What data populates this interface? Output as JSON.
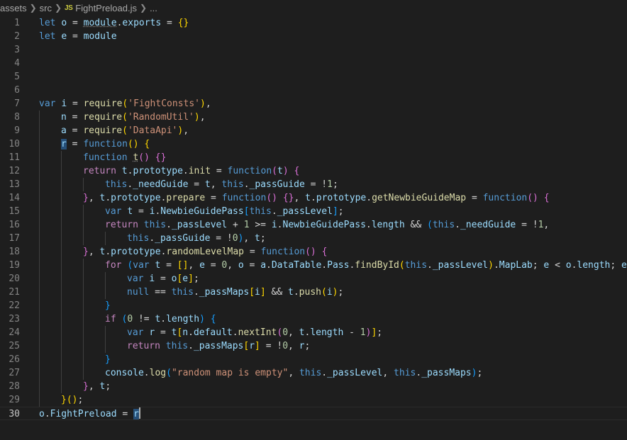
{
  "breadcrumb": {
    "items": [
      "assets",
      "src",
      "FightPreload.js",
      "..."
    ],
    "file_icon": "JS"
  },
  "editor": {
    "current_line": 30,
    "lines": [
      {
        "n": "1",
        "indent": 0,
        "tokens": [
          [
            "let",
            "kw"
          ],
          [
            " "
          ],
          [
            "o",
            "var"
          ],
          [
            " = "
          ],
          [
            "module",
            "var",
            "dot"
          ],
          [
            "."
          ],
          [
            "exports",
            "var"
          ],
          [
            " = "
          ],
          [
            "{}",
            "b1"
          ]
        ]
      },
      {
        "n": "2",
        "indent": 0,
        "tokens": [
          [
            "let",
            "kw"
          ],
          [
            " "
          ],
          [
            "e",
            "var"
          ],
          [
            " = "
          ],
          [
            "module",
            "var"
          ]
        ]
      },
      {
        "n": "3",
        "indent": 0,
        "tokens": []
      },
      {
        "n": "4",
        "indent": 0,
        "tokens": []
      },
      {
        "n": "5",
        "indent": 0,
        "tokens": []
      },
      {
        "n": "6",
        "indent": 0,
        "tokens": []
      },
      {
        "n": "7",
        "indent": 0,
        "tokens": [
          [
            "var",
            "kw"
          ],
          [
            " "
          ],
          [
            "i",
            "var"
          ],
          [
            " = "
          ],
          [
            "require",
            "fn"
          ],
          [
            "(",
            "b1"
          ],
          [
            "'FightConsts'",
            "str"
          ],
          [
            ")",
            "b1"
          ],
          [
            ","
          ]
        ]
      },
      {
        "n": "8",
        "indent": 1,
        "tokens": [
          [
            "n",
            "var"
          ],
          [
            " = "
          ],
          [
            "require",
            "fn"
          ],
          [
            "(",
            "b1"
          ],
          [
            "'RandomUtil'",
            "str"
          ],
          [
            ")",
            "b1"
          ],
          [
            ","
          ]
        ]
      },
      {
        "n": "9",
        "indent": 1,
        "tokens": [
          [
            "a",
            "var"
          ],
          [
            " = "
          ],
          [
            "require",
            "fn"
          ],
          [
            "(",
            "b1"
          ],
          [
            "'DataApi'",
            "str"
          ],
          [
            ")",
            "b1"
          ],
          [
            ","
          ]
        ]
      },
      {
        "n": "10",
        "indent": 1,
        "tokens": [
          [
            "r",
            "var",
            "hl"
          ],
          [
            " = "
          ],
          [
            "function",
            "kw"
          ],
          [
            "()",
            "b1"
          ],
          [
            " "
          ],
          [
            "{",
            "b1"
          ]
        ]
      },
      {
        "n": "11",
        "indent": 2,
        "tokens": [
          [
            "function",
            "kw"
          ],
          [
            " "
          ],
          [
            "t",
            "fn",
            "dot"
          ],
          [
            "()",
            "b2"
          ],
          [
            " "
          ],
          [
            "{}",
            "b2"
          ]
        ]
      },
      {
        "n": "12",
        "indent": 2,
        "tokens": [
          [
            "return",
            "ctl"
          ],
          [
            " "
          ],
          [
            "t",
            "var"
          ],
          [
            "."
          ],
          [
            "prototype",
            "var"
          ],
          [
            "."
          ],
          [
            "init",
            "fn"
          ],
          [
            " = "
          ],
          [
            "function",
            "kw"
          ],
          [
            "(",
            "b2"
          ],
          [
            "t",
            "var"
          ],
          [
            ")",
            "b2"
          ],
          [
            " "
          ],
          [
            "{",
            "b2"
          ]
        ]
      },
      {
        "n": "13",
        "indent": 3,
        "tokens": [
          [
            "this",
            "kw"
          ],
          [
            "."
          ],
          [
            "_needGuide",
            "var"
          ],
          [
            " = "
          ],
          [
            "t",
            "var"
          ],
          [
            ", "
          ],
          [
            "this",
            "kw"
          ],
          [
            "."
          ],
          [
            "_passGuide",
            "var"
          ],
          [
            " = !"
          ],
          [
            "1",
            "num"
          ],
          [
            ";"
          ]
        ]
      },
      {
        "n": "14",
        "indent": 2,
        "tokens": [
          [
            "}",
            "b2"
          ],
          [
            ", "
          ],
          [
            "t",
            "var"
          ],
          [
            "."
          ],
          [
            "prototype",
            "var"
          ],
          [
            "."
          ],
          [
            "prepare",
            "fn"
          ],
          [
            " = "
          ],
          [
            "function",
            "kw"
          ],
          [
            "()",
            "b2"
          ],
          [
            " "
          ],
          [
            "{}",
            "b2"
          ],
          [
            ", "
          ],
          [
            "t",
            "var"
          ],
          [
            "."
          ],
          [
            "prototype",
            "var"
          ],
          [
            "."
          ],
          [
            "getNewbieGuideMap",
            "fn"
          ],
          [
            " = "
          ],
          [
            "function",
            "kw"
          ],
          [
            "()",
            "b2"
          ],
          [
            " "
          ],
          [
            "{",
            "b2"
          ]
        ]
      },
      {
        "n": "15",
        "indent": 3,
        "tokens": [
          [
            "var",
            "kw"
          ],
          [
            " "
          ],
          [
            "t",
            "var"
          ],
          [
            " = "
          ],
          [
            "i",
            "var"
          ],
          [
            "."
          ],
          [
            "NewbieGuidePass",
            "var"
          ],
          [
            "[",
            "b3"
          ],
          [
            "this",
            "kw"
          ],
          [
            "."
          ],
          [
            "_passLevel",
            "var"
          ],
          [
            "]",
            "b3"
          ],
          [
            ";"
          ]
        ]
      },
      {
        "n": "16",
        "indent": 3,
        "tokens": [
          [
            "return",
            "ctl"
          ],
          [
            " "
          ],
          [
            "this",
            "kw"
          ],
          [
            "."
          ],
          [
            "_passLevel",
            "var"
          ],
          [
            " + "
          ],
          [
            "1",
            "num"
          ],
          [
            " >= "
          ],
          [
            "i",
            "var"
          ],
          [
            "."
          ],
          [
            "NewbieGuidePass",
            "var"
          ],
          [
            "."
          ],
          [
            "length",
            "var"
          ],
          [
            " && "
          ],
          [
            "(",
            "b3"
          ],
          [
            "this",
            "kw"
          ],
          [
            "."
          ],
          [
            "_needGuide",
            "var"
          ],
          [
            " = !"
          ],
          [
            "1",
            "num"
          ],
          [
            ","
          ]
        ]
      },
      {
        "n": "17",
        "indent": 4,
        "tokens": [
          [
            "this",
            "kw"
          ],
          [
            "."
          ],
          [
            "_passGuide",
            "var"
          ],
          [
            " = !"
          ],
          [
            "0",
            "num"
          ],
          [
            ")",
            "b3"
          ],
          [
            ", "
          ],
          [
            "t",
            "var"
          ],
          [
            ";"
          ]
        ]
      },
      {
        "n": "18",
        "indent": 2,
        "tokens": [
          [
            "}",
            "b2"
          ],
          [
            ", "
          ],
          [
            "t",
            "var"
          ],
          [
            "."
          ],
          [
            "prototype",
            "var"
          ],
          [
            "."
          ],
          [
            "randomLevelMap",
            "fn"
          ],
          [
            " = "
          ],
          [
            "function",
            "kw"
          ],
          [
            "()",
            "b2"
          ],
          [
            " "
          ],
          [
            "{",
            "b2"
          ]
        ]
      },
      {
        "n": "19",
        "indent": 3,
        "tokens": [
          [
            "for",
            "ctl"
          ],
          [
            " "
          ],
          [
            "(",
            "b3"
          ],
          [
            "var",
            "kw"
          ],
          [
            " "
          ],
          [
            "t",
            "var"
          ],
          [
            " = "
          ],
          [
            "[]",
            "b1"
          ],
          [
            ", "
          ],
          [
            "e",
            "var"
          ],
          [
            " = "
          ],
          [
            "0",
            "num"
          ],
          [
            ", "
          ],
          [
            "o",
            "var"
          ],
          [
            " = "
          ],
          [
            "a",
            "var"
          ],
          [
            "."
          ],
          [
            "DataTable",
            "var"
          ],
          [
            "."
          ],
          [
            "Pass",
            "var"
          ],
          [
            "."
          ],
          [
            "findById",
            "fn"
          ],
          [
            "(",
            "b1"
          ],
          [
            "this",
            "kw"
          ],
          [
            "."
          ],
          [
            "_passLevel",
            "var"
          ],
          [
            ")",
            "b1"
          ],
          [
            "."
          ],
          [
            "MapLab",
            "var"
          ],
          [
            "; "
          ],
          [
            "e",
            "var"
          ],
          [
            " < "
          ],
          [
            "o",
            "var"
          ],
          [
            "."
          ],
          [
            "length",
            "var"
          ],
          [
            "; "
          ],
          [
            "e++",
            "var"
          ]
        ]
      },
      {
        "n": "20",
        "indent": 4,
        "tokens": [
          [
            "var",
            "kw"
          ],
          [
            " "
          ],
          [
            "i",
            "var"
          ],
          [
            " = "
          ],
          [
            "o",
            "var"
          ],
          [
            "[",
            "b1"
          ],
          [
            "e",
            "var"
          ],
          [
            "]",
            "b1"
          ],
          [
            ";"
          ]
        ]
      },
      {
        "n": "21",
        "indent": 4,
        "tokens": [
          [
            "null",
            "kw"
          ],
          [
            " == "
          ],
          [
            "this",
            "kw"
          ],
          [
            "."
          ],
          [
            "_passMaps",
            "var"
          ],
          [
            "[",
            "b1"
          ],
          [
            "i",
            "var"
          ],
          [
            "]",
            "b1"
          ],
          [
            " && "
          ],
          [
            "t",
            "var"
          ],
          [
            "."
          ],
          [
            "push",
            "fn"
          ],
          [
            "(",
            "b1"
          ],
          [
            "i",
            "var"
          ],
          [
            ")",
            "b1"
          ],
          [
            ";"
          ]
        ]
      },
      {
        "n": "22",
        "indent": 3,
        "tokens": [
          [
            "}",
            "b3"
          ]
        ]
      },
      {
        "n": "23",
        "indent": 3,
        "tokens": [
          [
            "if",
            "ctl"
          ],
          [
            " "
          ],
          [
            "(",
            "b3"
          ],
          [
            "0",
            "num"
          ],
          [
            " != "
          ],
          [
            "t",
            "var"
          ],
          [
            "."
          ],
          [
            "length",
            "var"
          ],
          [
            ")",
            "b3"
          ],
          [
            " "
          ],
          [
            "{",
            "b3"
          ]
        ]
      },
      {
        "n": "24",
        "indent": 4,
        "tokens": [
          [
            "var",
            "kw"
          ],
          [
            " "
          ],
          [
            "r",
            "var"
          ],
          [
            " = "
          ],
          [
            "t",
            "var"
          ],
          [
            "[",
            "b1"
          ],
          [
            "n",
            "var"
          ],
          [
            "."
          ],
          [
            "default",
            "var"
          ],
          [
            "."
          ],
          [
            "nextInt",
            "fn"
          ],
          [
            "(",
            "b2"
          ],
          [
            "0",
            "num"
          ],
          [
            ", "
          ],
          [
            "t",
            "var"
          ],
          [
            "."
          ],
          [
            "length",
            "var"
          ],
          [
            " - "
          ],
          [
            "1",
            "num"
          ],
          [
            ")",
            "b2"
          ],
          [
            "]",
            "b1"
          ],
          [
            ";"
          ]
        ]
      },
      {
        "n": "25",
        "indent": 4,
        "tokens": [
          [
            "return",
            "ctl"
          ],
          [
            " "
          ],
          [
            "this",
            "kw"
          ],
          [
            "."
          ],
          [
            "_passMaps",
            "var"
          ],
          [
            "[",
            "b1"
          ],
          [
            "r",
            "var"
          ],
          [
            "]",
            "b1"
          ],
          [
            " = !"
          ],
          [
            "0",
            "num"
          ],
          [
            ", "
          ],
          [
            "r",
            "var"
          ],
          [
            ";"
          ]
        ]
      },
      {
        "n": "26",
        "indent": 3,
        "tokens": [
          [
            "}",
            "b3"
          ]
        ]
      },
      {
        "n": "27",
        "indent": 3,
        "tokens": [
          [
            "console",
            "var"
          ],
          [
            "."
          ],
          [
            "log",
            "fn"
          ],
          [
            "(",
            "b3"
          ],
          [
            "\"random map is empty\"",
            "str"
          ],
          [
            ", "
          ],
          [
            "this",
            "kw"
          ],
          [
            "."
          ],
          [
            "_passLevel",
            "var"
          ],
          [
            ", "
          ],
          [
            "this",
            "kw"
          ],
          [
            "."
          ],
          [
            "_passMaps",
            "var"
          ],
          [
            ")",
            "b3"
          ],
          [
            ";"
          ]
        ]
      },
      {
        "n": "28",
        "indent": 2,
        "tokens": [
          [
            "}",
            "b2"
          ],
          [
            ", "
          ],
          [
            "t",
            "var"
          ],
          [
            ";"
          ]
        ]
      },
      {
        "n": "29",
        "indent": 1,
        "tokens": [
          [
            "}",
            "b1"
          ],
          [
            "()",
            "b1"
          ],
          [
            ";"
          ]
        ]
      },
      {
        "n": "30",
        "indent": 0,
        "tokens": [
          [
            "o",
            "var"
          ],
          [
            "."
          ],
          [
            "FightPreload",
            "var"
          ],
          [
            " = "
          ],
          [
            "r",
            "var",
            "hl"
          ]
        ]
      }
    ]
  }
}
